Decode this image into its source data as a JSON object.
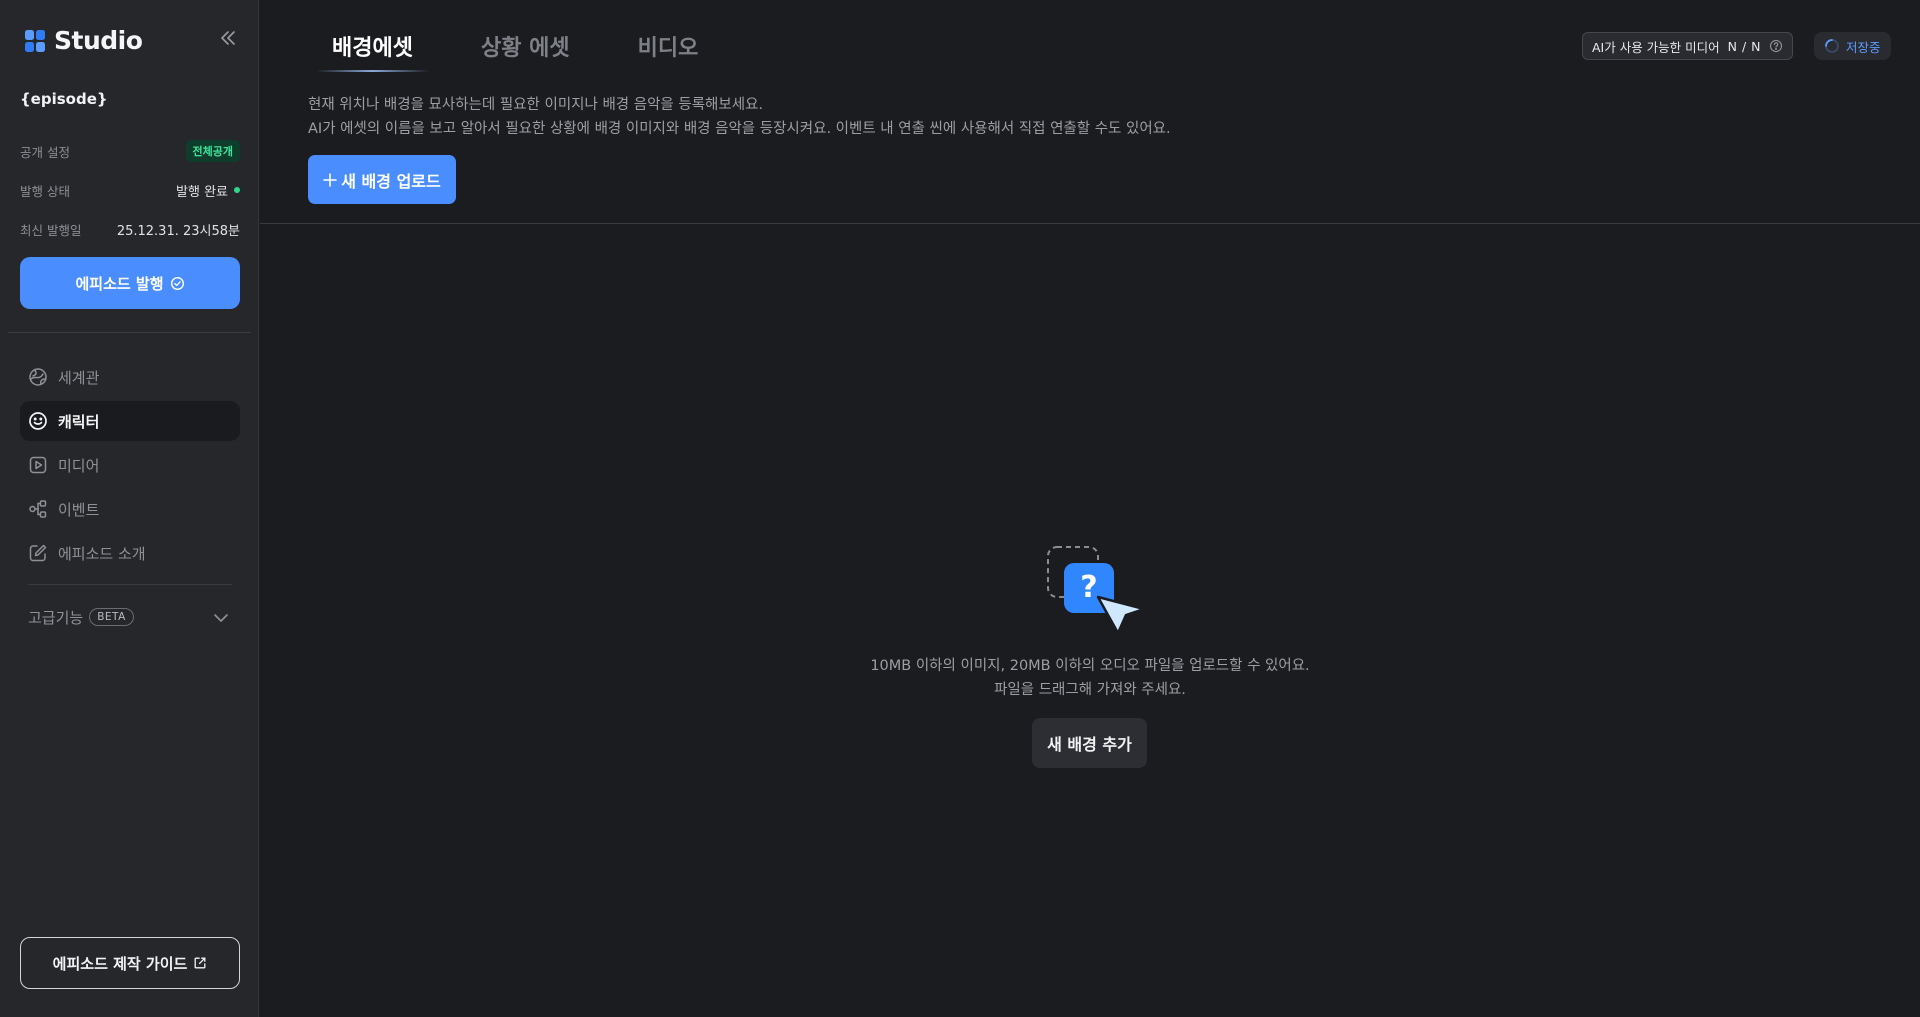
{
  "sidebar": {
    "brand": "Studio",
    "episode_title": "{episode}",
    "meta": {
      "visibility_label": "공개 설정",
      "visibility_value": "전체공개",
      "status_label": "발행 상태",
      "status_value": "발행 완료",
      "date_label": "최신 발행일",
      "date_value": "25.12.31. 23시58분"
    },
    "publish_label": "에피소드 발행",
    "nav": [
      {
        "label": "세계관",
        "icon": "globe-icon"
      },
      {
        "label": "캐릭터",
        "icon": "smile-icon"
      },
      {
        "label": "미디어",
        "icon": "play-icon"
      },
      {
        "label": "이벤트",
        "icon": "nodes-icon"
      },
      {
        "label": "에피소드 소개",
        "icon": "edit-icon"
      }
    ],
    "advanced_label": "고급기능",
    "beta_label": "BETA",
    "guide_label": "에피소드 제작 가이드"
  },
  "main": {
    "tabs": [
      {
        "label": "배경에셋",
        "active": true
      },
      {
        "label": "상황 에셋",
        "active": false
      },
      {
        "label": "비디오",
        "active": false
      }
    ],
    "media_usage_label": "AI가 사용 가능한 미디어",
    "media_usage_count": "N / N",
    "saving_label": "저장중",
    "description_line1": "현재 위치나 배경을 묘사하는데 필요한 이미지나 배경 음악을 등록해보세요.",
    "description_line2": "AI가 에셋의 이름을 보고 알아서 필요한 상황에 배경 이미지와 배경 음악을 등장시켜요. 이벤트 내 연출 씬에 사용해서 직접 연출할 수도 있어요.",
    "upload_label": "새 배경 업로드",
    "empty_line1": "10MB 이하의 이미지, 20MB 이하의 오디오 파일을 업로드할 수 있어요.",
    "empty_line2": "파일을 드래그해 가져와 주세요.",
    "add_bg_label": "새 배경 추가"
  },
  "colors": {
    "accent": "#4a8dff",
    "background": "#1b1c1f",
    "sidebar": "#26272b",
    "success": "#2fd889"
  }
}
